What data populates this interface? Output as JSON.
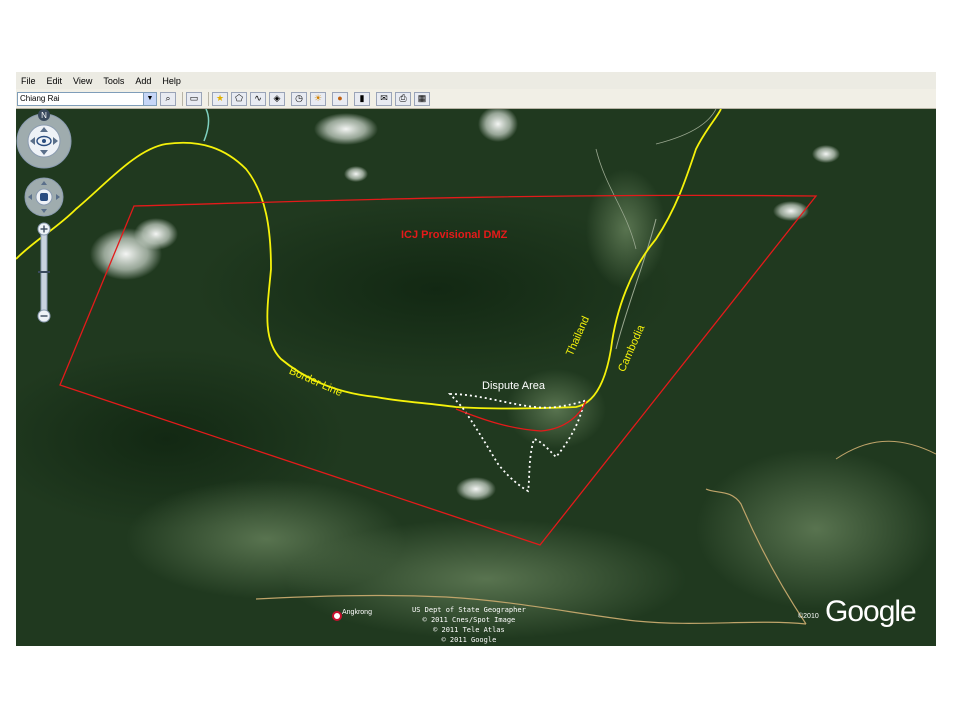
{
  "menu": [
    "File",
    "Edit",
    "View",
    "Tools",
    "Add",
    "Help"
  ],
  "search": {
    "value": "Chiang Rai"
  },
  "toolbar_icons": [
    "search-icon",
    "sidebar-icon",
    "placemark-icon",
    "polygon-icon",
    "path-icon",
    "overlay-icon",
    "history-icon",
    "sun-icon",
    "planet-icon",
    "ruler-icon",
    "email-icon",
    "print-icon",
    "image-icon"
  ],
  "map": {
    "labels": {
      "dmz": "ICJ Provisional DMZ",
      "border": "Border Line",
      "thailand": "Thailand",
      "cambodia": "Cambodia",
      "dispute": "Dispute Area",
      "town": "Angkrong"
    },
    "credits": [
      "US Dept of State Geographer",
      "© 2011 Cnes/Spot Image",
      "© 2011 Tele Atlas",
      "© 2011 Google"
    ],
    "logo": "Google",
    "logo_year": "©2010",
    "colors": {
      "dmz": "#e41a1a",
      "border": "#f5f20a",
      "dispute": "#ffffff",
      "terrain": "#1f3a1f"
    }
  }
}
